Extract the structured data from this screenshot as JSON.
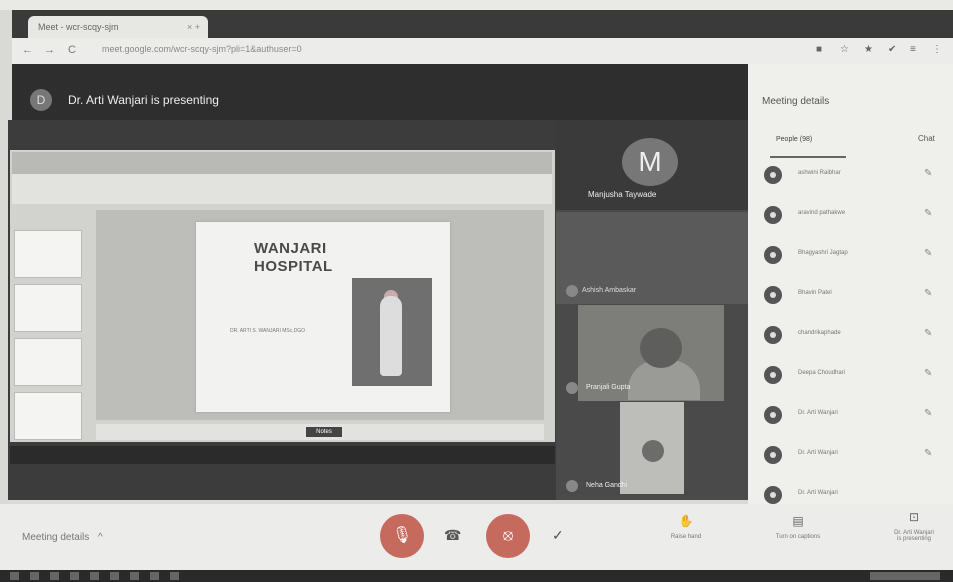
{
  "browser": {
    "tab_title": "Meet - wcr-scqy-sjm",
    "tab_close": "× +",
    "url": "meet.google.com/wcr-scqy-sjm?pli=1&authuser=0",
    "nav": [
      "←",
      "→",
      "C"
    ],
    "extensions": [
      "■",
      "☆",
      "★",
      "✔",
      "≡",
      "⋮"
    ]
  },
  "meeting": {
    "presenter_initial": "D",
    "presenting_text": "Dr. Arti Wanjari is presenting"
  },
  "slide": {
    "title_line1": "WANJARI",
    "title_line2": "HOSPITAL",
    "subtitle": "DR. ARTI S. WANJARI MSc,DGO",
    "status_button": "Notes"
  },
  "tiles": {
    "m_initial": "M",
    "m_name": "Manjusha Taywade",
    "tile2_name": "Ashish Ambaskar",
    "tile3_name": "Pranjali Gupta",
    "tile4_name": "Neha Gandhi"
  },
  "panel": {
    "title": "Meeting details",
    "people_tab": "People (98)",
    "chat_tab": "Chat",
    "people": [
      {
        "name": "ashwini Raibhar"
      },
      {
        "name": "aravind pathakwe"
      },
      {
        "name": "Bhagyashri Jagtap"
      },
      {
        "name": "Bhavin Patel"
      },
      {
        "name": "chandrikaphade"
      },
      {
        "name": "Deepa Choudhari"
      },
      {
        "name": "Dr. Arti Wanjari"
      },
      {
        "name": "Dr. Arti Wanjari"
      },
      {
        "name": "Dr. Arti Wanjari"
      }
    ]
  },
  "controls": {
    "meeting_details": "Meeting details",
    "caret": "^",
    "mic_icon": "🎙",
    "cam_icon": "⦻",
    "hangup_icon": "☎",
    "check_icon": "✓",
    "raise_hand": "Raise hand",
    "captions": "Turn on captions",
    "presenting_line1": "Dr. Arti Wanjari",
    "presenting_line2": "is presenting"
  },
  "colors": {
    "control_red": "#c66a5e",
    "meet_dark": "#2e2e2e"
  }
}
